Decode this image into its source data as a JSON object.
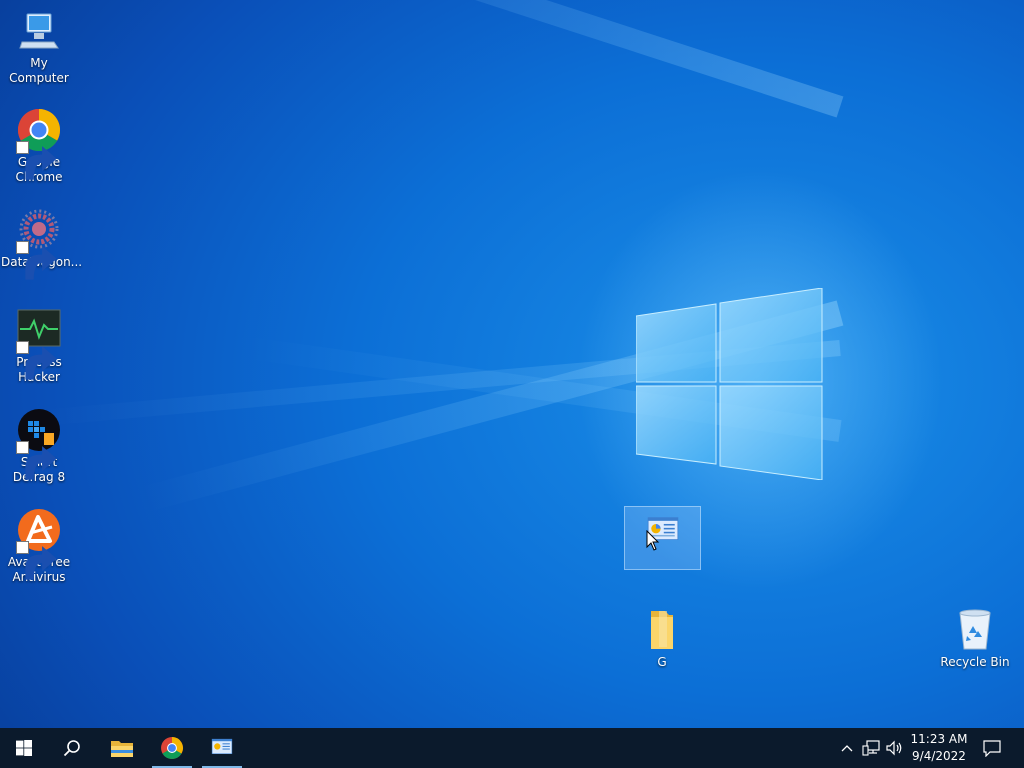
{
  "desktop": {
    "icons": [
      {
        "label": "My Computer",
        "icon": "computer-icon"
      },
      {
        "label": "Google Chrome",
        "icon": "chrome-icon"
      },
      {
        "label": "DataWagon...",
        "icon": "datawagon-icon"
      },
      {
        "label": "Process Hacker",
        "icon": "process-hacker-icon"
      },
      {
        "label": "Smart Defrag 8",
        "icon": "smart-defrag-icon"
      },
      {
        "label": "Avast Free Antivirus",
        "icon": "avast-icon"
      }
    ],
    "selected_icon": {
      "label": "",
      "icon": "control-panel-icon"
    },
    "folder": {
      "label": "G",
      "icon": "folder-icon"
    },
    "recycle_bin": {
      "label": "Recycle Bin",
      "icon": "recycle-bin-icon"
    }
  },
  "taskbar": {
    "buttons": [
      {
        "name": "start",
        "icon": "windows-start-icon"
      },
      {
        "name": "search",
        "icon": "search-icon"
      },
      {
        "name": "file-explorer",
        "icon": "folder-icon"
      },
      {
        "name": "chrome",
        "icon": "chrome-icon"
      },
      {
        "name": "control-panel",
        "icon": "control-panel-icon"
      }
    ],
    "tray": {
      "time": "11:23 AM",
      "date": "9/4/2022"
    }
  },
  "colors": {
    "desktop_blue": "#0c6fd6",
    "taskbar": "#0b1a2c"
  }
}
